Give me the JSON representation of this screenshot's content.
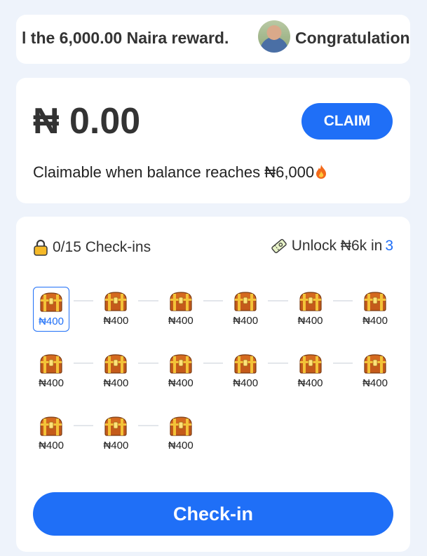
{
  "ticker": {
    "text_1": "l the 6,000.00 Naira reward.",
    "text_2": "Congratulation"
  },
  "balance": {
    "amount": "₦ 0.00",
    "claim_label": "CLAIM",
    "note": "Claimable when balance reaches ₦6,000",
    "note_icon": "fire-icon"
  },
  "checkin": {
    "progress": "0/15 Check-ins",
    "progress_icon": "lock-icon",
    "unlock_text": "Unlock ₦6k in",
    "unlock_days": "3",
    "unlock_icon": "ticket-icon",
    "days": [
      {
        "label": "₦400",
        "active": true
      },
      {
        "label": "₦400",
        "active": false
      },
      {
        "label": "₦400",
        "active": false
      },
      {
        "label": "₦400",
        "active": false
      },
      {
        "label": "₦400",
        "active": false
      },
      {
        "label": "₦400",
        "active": false
      },
      {
        "label": "₦400",
        "active": false
      },
      {
        "label": "₦400",
        "active": false
      },
      {
        "label": "₦400",
        "active": false
      },
      {
        "label": "₦400",
        "active": false
      },
      {
        "label": "₦400",
        "active": false
      },
      {
        "label": "₦400",
        "active": false
      },
      {
        "label": "₦400",
        "active": false
      },
      {
        "label": "₦400",
        "active": false
      },
      {
        "label": "₦400",
        "active": false
      }
    ],
    "button_label": "Check-in"
  },
  "colors": {
    "accent": "#1f6ff7",
    "background": "#eef3fb"
  }
}
